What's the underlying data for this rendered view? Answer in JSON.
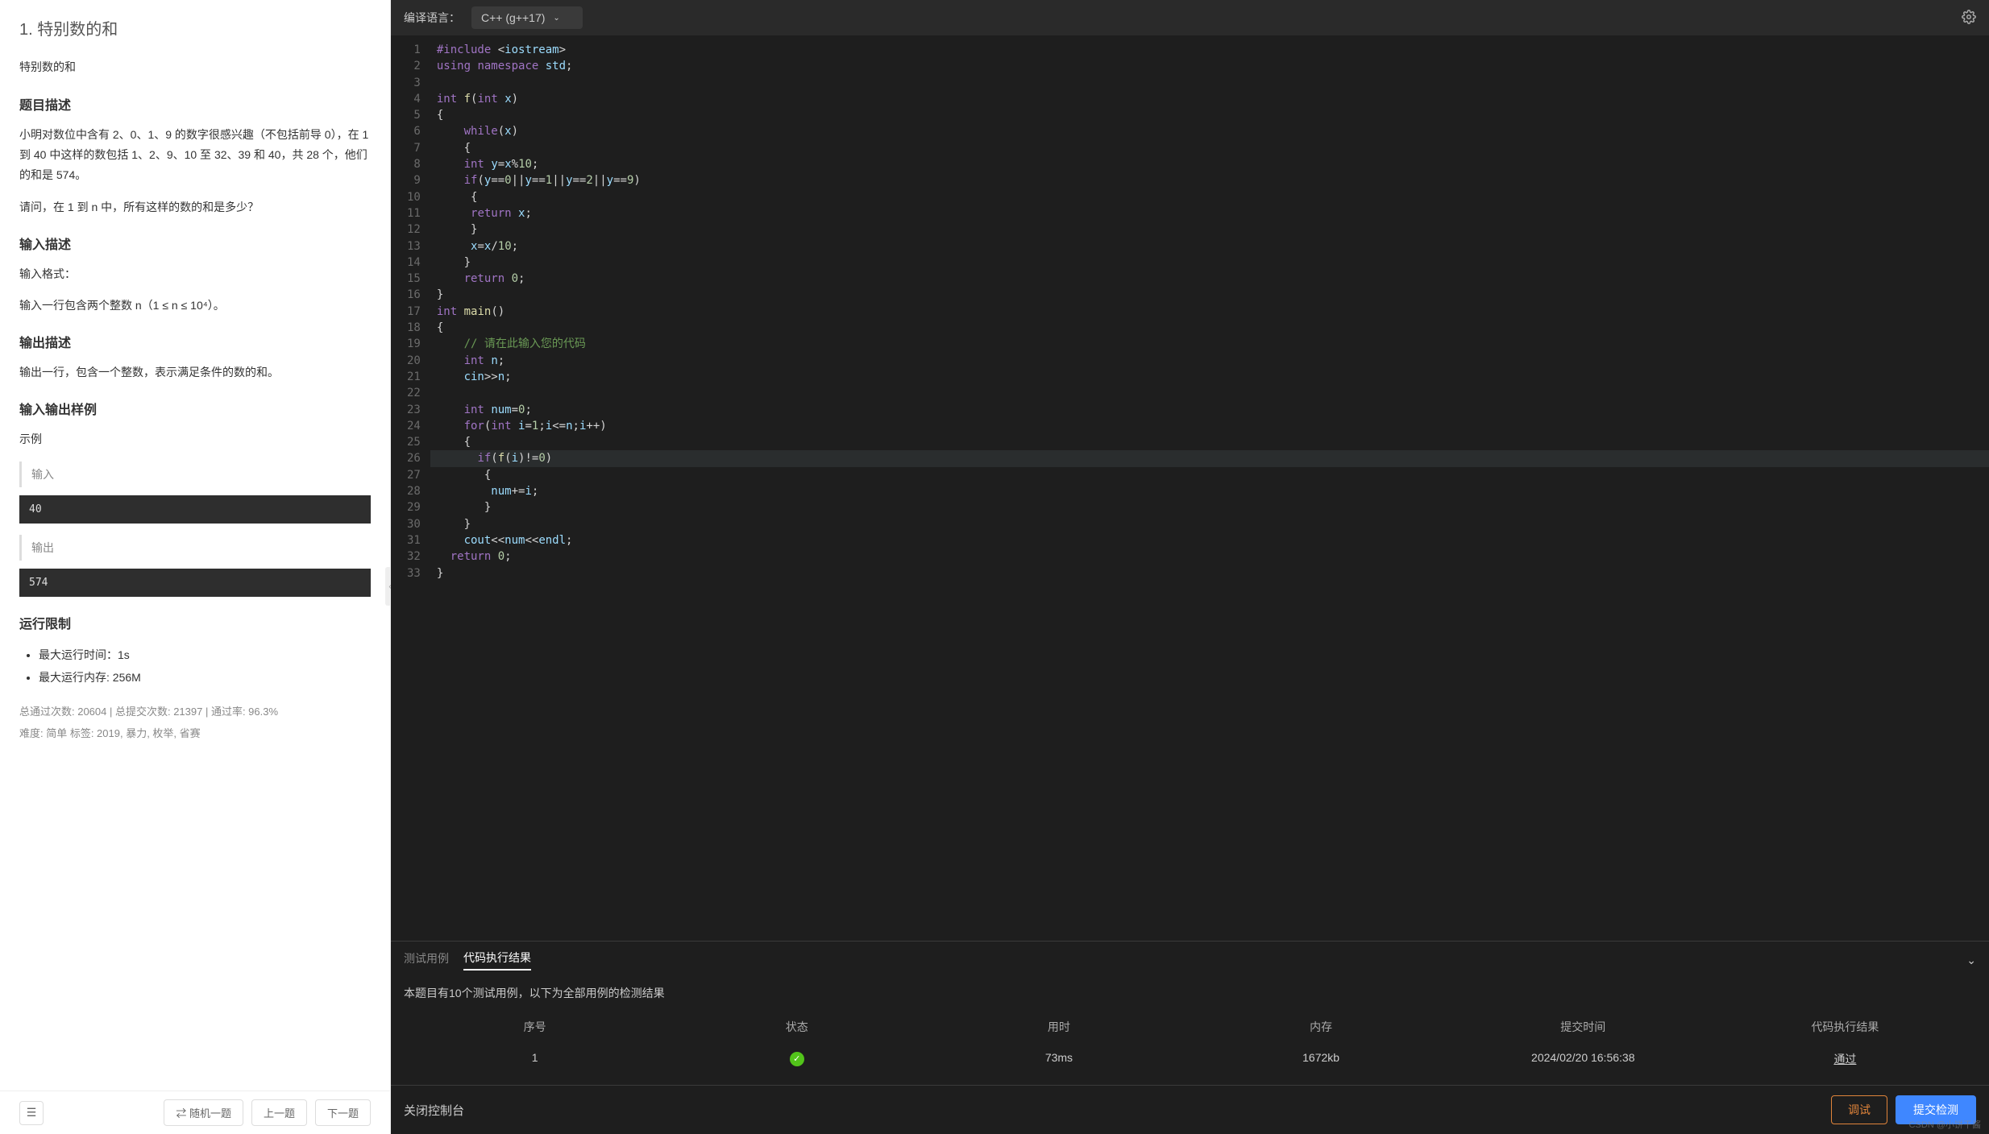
{
  "problem": {
    "title": "1. 特别数的和",
    "subtitle": "特别数的和",
    "desc_head": "题目描述",
    "desc_p1": "小明对数位中含有 2、0、1、9 的数字很感兴趣（不包括前导 0），在 1 到 40 中这样的数包括 1、2、9、10 至 32、39 和 40，共 28 个，他们的和是 574。",
    "desc_p2": "请问，在 1 到 n 中，所有这样的数的和是多少？",
    "input_head": "输入描述",
    "input_p1": "输入格式：",
    "input_p2": "输入一行包含两个整数 n（1 ≤ n ≤ 10⁴）。",
    "output_head": "输出描述",
    "output_p1": "输出一行，包含一个整数，表示满足条件的数的和。",
    "sample_head": "输入输出样例",
    "sample_label": "示例",
    "input_label": "输入",
    "input_val": "40",
    "output_label": "输出",
    "output_val": "574",
    "limit_head": "运行限制",
    "limit_time": "最大运行时间：1s",
    "limit_mem": "最大运行内存: 256M",
    "stats": "总通过次数: 20604  |  总提交次数: 21397  |  通过率: 96.3%",
    "tags": "难度: 简单    标签: 2019, 暴力, 枚举, 省赛"
  },
  "nav": {
    "random": "⇄ 随机一题",
    "prev": "上一题",
    "next": "下一题"
  },
  "editor": {
    "lang_label": "编译语言：",
    "lang_value": "C++ (g++17)",
    "lines": [
      [
        [
          "pp",
          "#include"
        ],
        [
          "op",
          " <"
        ],
        [
          "id",
          "iostream"
        ],
        [
          "op",
          ">"
        ]
      ],
      [
        [
          "kw",
          "using"
        ],
        [
          "op",
          " "
        ],
        [
          "kw",
          "namespace"
        ],
        [
          "op",
          " "
        ],
        [
          "id",
          "std"
        ],
        [
          "op",
          ";"
        ]
      ],
      [],
      [
        [
          "ty",
          "int"
        ],
        [
          "op",
          " "
        ],
        [
          "fn",
          "f"
        ],
        [
          "op",
          "("
        ],
        [
          "ty",
          "int"
        ],
        [
          "op",
          " "
        ],
        [
          "id",
          "x"
        ],
        [
          "op",
          ")"
        ]
      ],
      [
        [
          "op",
          "{"
        ]
      ],
      [
        [
          "op",
          "    "
        ],
        [
          "kw",
          "while"
        ],
        [
          "op",
          "("
        ],
        [
          "id",
          "x"
        ],
        [
          "op",
          ")"
        ]
      ],
      [
        [
          "op",
          "    {"
        ]
      ],
      [
        [
          "op",
          "    "
        ],
        [
          "ty",
          "int"
        ],
        [
          "op",
          " "
        ],
        [
          "id",
          "y"
        ],
        [
          "op",
          "="
        ],
        [
          "id",
          "x"
        ],
        [
          "op",
          "%"
        ],
        [
          "num",
          "10"
        ],
        [
          "op",
          ";"
        ]
      ],
      [
        [
          "op",
          "    "
        ],
        [
          "kw",
          "if"
        ],
        [
          "op",
          "("
        ],
        [
          "id",
          "y"
        ],
        [
          "op",
          "=="
        ],
        [
          "num",
          "0"
        ],
        [
          "op",
          "||"
        ],
        [
          "id",
          "y"
        ],
        [
          "op",
          "=="
        ],
        [
          "num",
          "1"
        ],
        [
          "op",
          "||"
        ],
        [
          "id",
          "y"
        ],
        [
          "op",
          "=="
        ],
        [
          "num",
          "2"
        ],
        [
          "op",
          "||"
        ],
        [
          "id",
          "y"
        ],
        [
          "op",
          "=="
        ],
        [
          "num",
          "9"
        ],
        [
          "op",
          ")"
        ]
      ],
      [
        [
          "op",
          "     {"
        ]
      ],
      [
        [
          "op",
          "     "
        ],
        [
          "kw",
          "return"
        ],
        [
          "op",
          " "
        ],
        [
          "id",
          "x"
        ],
        [
          "op",
          ";"
        ]
      ],
      [
        [
          "op",
          "     }"
        ]
      ],
      [
        [
          "op",
          "     "
        ],
        [
          "id",
          "x"
        ],
        [
          "op",
          "="
        ],
        [
          "id",
          "x"
        ],
        [
          "op",
          "/"
        ],
        [
          "num",
          "10"
        ],
        [
          "op",
          ";"
        ]
      ],
      [
        [
          "op",
          "    }"
        ]
      ],
      [
        [
          "op",
          "    "
        ],
        [
          "kw",
          "return"
        ],
        [
          "op",
          " "
        ],
        [
          "num",
          "0"
        ],
        [
          "op",
          ";"
        ]
      ],
      [
        [
          "op",
          "}"
        ]
      ],
      [
        [
          "ty",
          "int"
        ],
        [
          "op",
          " "
        ],
        [
          "fn",
          "main"
        ],
        [
          "op",
          "()"
        ]
      ],
      [
        [
          "op",
          "{"
        ]
      ],
      [
        [
          "op",
          "    "
        ],
        [
          "cm",
          "// 请在此输入您的代码"
        ]
      ],
      [
        [
          "op",
          "    "
        ],
        [
          "ty",
          "int"
        ],
        [
          "op",
          " "
        ],
        [
          "id",
          "n"
        ],
        [
          "op",
          ";"
        ]
      ],
      [
        [
          "op",
          "    "
        ],
        [
          "id",
          "cin"
        ],
        [
          "op",
          ">>"
        ],
        [
          "id",
          "n"
        ],
        [
          "op",
          ";"
        ]
      ],
      [],
      [
        [
          "op",
          "    "
        ],
        [
          "ty",
          "int"
        ],
        [
          "op",
          " "
        ],
        [
          "id",
          "num"
        ],
        [
          "op",
          "="
        ],
        [
          "num",
          "0"
        ],
        [
          "op",
          ";"
        ]
      ],
      [
        [
          "op",
          "    "
        ],
        [
          "kw",
          "for"
        ],
        [
          "op",
          "("
        ],
        [
          "ty",
          "int"
        ],
        [
          "op",
          " "
        ],
        [
          "id",
          "i"
        ],
        [
          "op",
          "="
        ],
        [
          "num",
          "1"
        ],
        [
          "op",
          ";"
        ],
        [
          "id",
          "i"
        ],
        [
          "op",
          "<="
        ],
        [
          "id",
          "n"
        ],
        [
          "op",
          ";"
        ],
        [
          "id",
          "i"
        ],
        [
          "op",
          "++)"
        ]
      ],
      [
        [
          "op",
          "    {"
        ]
      ],
      [
        [
          "op",
          "      "
        ],
        [
          "kw",
          "if"
        ],
        [
          "op",
          "("
        ],
        [
          "fn",
          "f"
        ],
        [
          "op",
          "("
        ],
        [
          "id",
          "i"
        ],
        [
          "op",
          ")!="
        ],
        [
          "num",
          "0"
        ],
        [
          "op",
          ")"
        ]
      ],
      [
        [
          "op",
          "       {"
        ]
      ],
      [
        [
          "op",
          "        "
        ],
        [
          "id",
          "num"
        ],
        [
          "op",
          "+="
        ],
        [
          "id",
          "i"
        ],
        [
          "op",
          ";"
        ]
      ],
      [
        [
          "op",
          "       }"
        ]
      ],
      [
        [
          "op",
          "    }"
        ]
      ],
      [
        [
          "op",
          "    "
        ],
        [
          "id",
          "cout"
        ],
        [
          "op",
          "<<"
        ],
        [
          "id",
          "num"
        ],
        [
          "op",
          "<<"
        ],
        [
          "id",
          "endl"
        ],
        [
          "op",
          ";"
        ]
      ],
      [
        [
          "op",
          "  "
        ],
        [
          "kw",
          "return"
        ],
        [
          "op",
          " "
        ],
        [
          "num",
          "0"
        ],
        [
          "op",
          ";"
        ]
      ],
      [
        [
          "op",
          "}"
        ]
      ]
    ],
    "highlight_line": 26
  },
  "results": {
    "tab1": "测试用例",
    "tab2": "代码执行结果",
    "summary": "本题目有10个测试用例，以下为全部用例的检测结果",
    "cols": {
      "c1": "序号",
      "c2": "状态",
      "c3": "用时",
      "c4": "内存",
      "c5": "提交时间",
      "c6": "代码执行结果"
    },
    "row": {
      "idx": "1",
      "time": "73ms",
      "mem": "1672kb",
      "submitted": "2024/02/20 16:56:38",
      "verdict": "通过"
    }
  },
  "footer": {
    "close": "关闭控制台",
    "debug": "调试",
    "submit": "提交检测"
  },
  "watermark": "CSDN @小饼干酱"
}
